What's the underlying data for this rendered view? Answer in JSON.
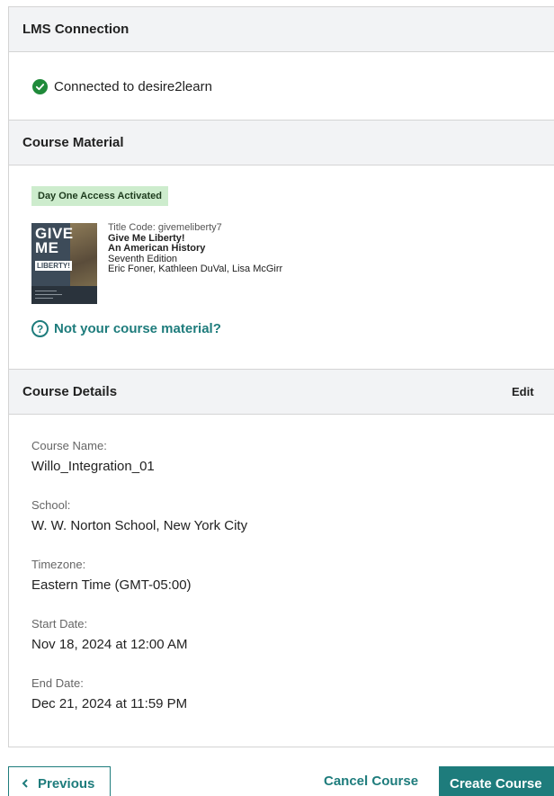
{
  "lms": {
    "title": "LMS Connection",
    "status": "Connected to desire2learn"
  },
  "material": {
    "title": "Course Material",
    "badge": "Day One Access Activated",
    "book": {
      "cover_line1": "GIVE",
      "cover_line2": "ME",
      "cover_line3": "LIBERTY!",
      "title_code_label": "Title Code:",
      "title_code": "givemeliberty7",
      "title": "Give Me Liberty!",
      "subtitle": "An American History",
      "edition": "Seventh Edition",
      "authors": "Eric Foner, Kathleen DuVal, Lisa McGirr"
    },
    "not_yours": "Not your course material?"
  },
  "details": {
    "title": "Course Details",
    "edit": "Edit",
    "fields": [
      {
        "label": "Course Name:",
        "value": "Willo_Integration_01"
      },
      {
        "label": "School:",
        "value": "W. W. Norton School, New York City"
      },
      {
        "label": "Timezone:",
        "value": "Eastern Time (GMT-05:00)"
      },
      {
        "label": "Start Date:",
        "value": "Nov 18, 2024 at 12:00 AM"
      },
      {
        "label": "End Date:",
        "value": "Dec 21, 2024 at 11:59 PM"
      }
    ]
  },
  "footer": {
    "previous": "Previous",
    "cancel": "Cancel Course",
    "create": "Create Course"
  },
  "colors": {
    "accent": "#1e7c7c",
    "success": "#1f8a3a",
    "badge_bg": "#cdeccd",
    "header_bg": "#f2f3f5"
  }
}
